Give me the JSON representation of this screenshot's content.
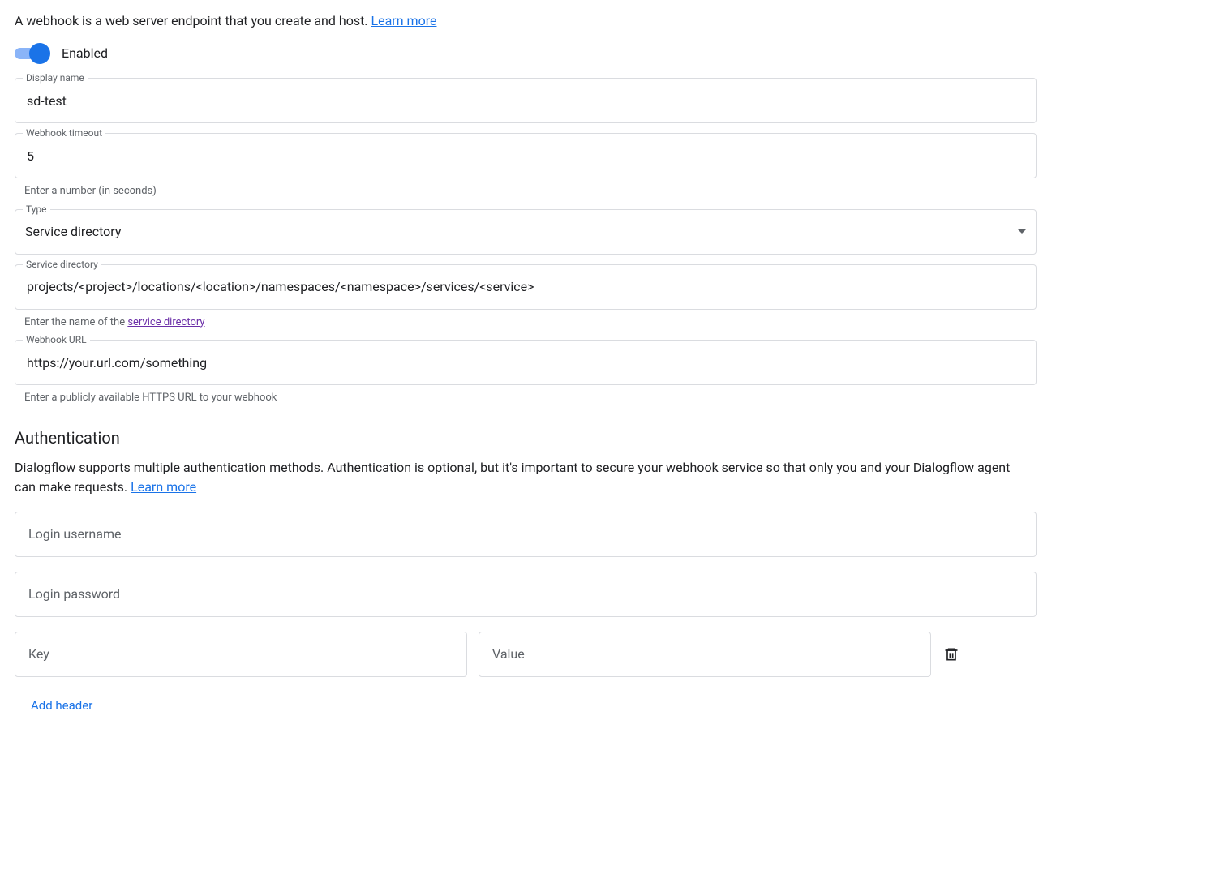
{
  "intro": {
    "text": "A webhook is a web server endpoint that you create and host. ",
    "link": "Learn more"
  },
  "toggle": {
    "enabled": true,
    "label": "Enabled"
  },
  "display_name": {
    "label": "Display name",
    "value": "sd-test"
  },
  "timeout": {
    "label": "Webhook timeout",
    "value": "5",
    "helper": "Enter a number (in seconds)"
  },
  "type": {
    "label": "Type",
    "value": "Service directory"
  },
  "service_dir": {
    "label": "Service directory",
    "value": "projects/<project>/locations/<location>/namespaces/<namespace>/services/<service>",
    "helper_prefix": "Enter the name of the ",
    "helper_link": "service directory"
  },
  "webhook_url": {
    "label": "Webhook URL",
    "value": "https://your.url.com/something",
    "helper": "Enter a publicly available HTTPS URL to your webhook"
  },
  "auth": {
    "heading": "Authentication",
    "desc": "Dialogflow supports multiple authentication methods. Authentication is optional, but it's important to secure your webhook service so that only you and your Dialogflow agent can make requests. ",
    "link": "Learn more",
    "username_placeholder": "Login username",
    "password_placeholder": "Login password",
    "key_placeholder": "Key",
    "value_placeholder": "Value",
    "add_header": "Add header"
  }
}
